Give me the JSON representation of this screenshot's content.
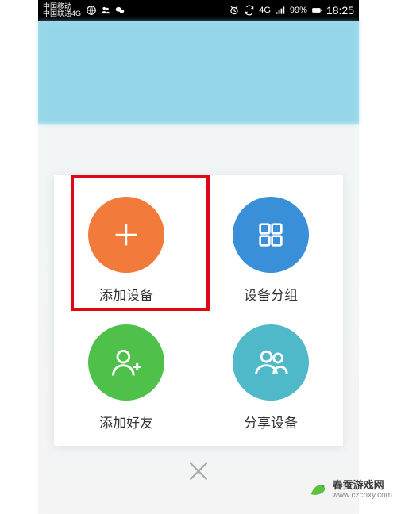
{
  "status": {
    "carrier1": "中国移动",
    "carrier2": "中国联通4G",
    "signal_type": "4G",
    "battery": "99%",
    "time": "18:25"
  },
  "panel": {
    "items": [
      {
        "label": "添加设备",
        "color": "#f27a3a",
        "icon": "plus"
      },
      {
        "label": "设备分组",
        "color": "#3a8fd9",
        "icon": "grid4"
      },
      {
        "label": "添加好友",
        "color": "#4fc14a",
        "icon": "add-friend"
      },
      {
        "label": "分享设备",
        "color": "#4fb8c9",
        "icon": "group"
      }
    ]
  },
  "highlight_index": 0,
  "watermark": {
    "name": "春蚕游戏网",
    "url": "www.czchxy.com"
  }
}
